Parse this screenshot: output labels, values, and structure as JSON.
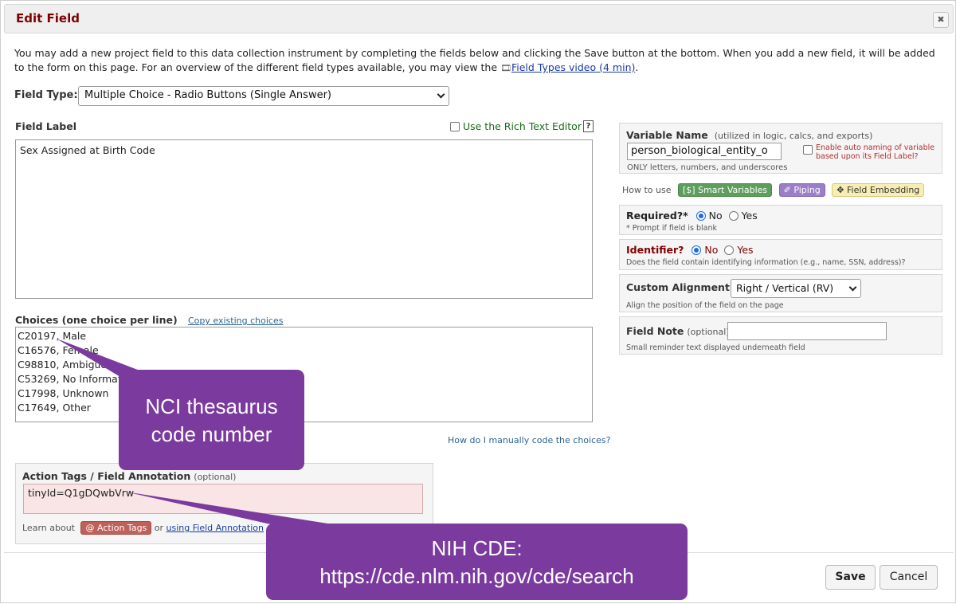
{
  "dialog": {
    "title": "Edit Field",
    "close_glyph": "✖"
  },
  "intro": {
    "text": "You may add a new project field to this data collection instrument by completing the fields below and clicking the Save button at the bottom. When you add a new field, it will be added to the form on this page. For an overview of the different field types available, you may view the",
    "film_glyph": "🎞",
    "video_link": "Field Types video (4 min)",
    "end": "."
  },
  "field_type": {
    "label": "Field Type:",
    "value": "Multiple Choice - Radio Buttons (Single Answer)"
  },
  "field_label": {
    "label": "Field Label",
    "rich_text_label": "Use the Rich Text Editor",
    "help_glyph": "?",
    "value": "Sex Assigned at Birth Code"
  },
  "choices": {
    "label": "Choices (one choice per line)",
    "copy_link": "Copy existing choices",
    "lines": [
      "C20197, Male",
      "C16576, Female",
      "C98810, Ambiguous",
      "C53269, No Information",
      "C17998, Unknown",
      "C17649, Other"
    ],
    "help_link": "How do I manually code the choices?"
  },
  "action_tags": {
    "label": "Action Tags / Field Annotation",
    "optional": "(optional)",
    "value": "tinyId=Q1gDQwbVrw",
    "learn_about": "Learn about",
    "action_tags_button": "@ Action Tags",
    "or": "or",
    "annotation_link": "using Field Annotation"
  },
  "variable": {
    "label": "Variable Name",
    "hint": "(utilized in logic, calcs, and exports)",
    "value": "person_biological_entity_o",
    "auto_naming": "Enable auto naming of variable based upon its Field Label?",
    "only_letters": "ONLY letters, numbers, and underscores"
  },
  "how_to_use": {
    "label": "How to use",
    "smart_variables": "[$] Smart Variables",
    "piping": "✐ Piping",
    "field_embedding": "✥ Field Embedding"
  },
  "required": {
    "label": "Required?*",
    "no": "No",
    "yes": "Yes",
    "note": "* Prompt if field is blank",
    "selected": "No"
  },
  "identifier": {
    "label": "Identifier?",
    "no": "No",
    "yes": "Yes",
    "note": "Does the field contain identifying information (e.g., name, SSN, address)?",
    "selected": "No"
  },
  "alignment": {
    "label": "Custom Alignment",
    "value": "Right / Vertical (RV)",
    "note": "Align the position of the field on the page"
  },
  "field_note": {
    "label": "Field Note",
    "optional": "(optional)",
    "value": "",
    "note": "Small reminder text displayed underneath field"
  },
  "footer": {
    "save": "Save",
    "cancel": "Cancel"
  },
  "callouts": {
    "nci_line1": "NCI thesaurus",
    "nci_line2": "code number",
    "nih_line1": "NIH CDE:",
    "nih_line2": "https://cde.nlm.nih.gov/cde/search"
  },
  "colors": {
    "title": "#800000",
    "callout": "#7a3a9e",
    "link": "#1a3c9c"
  }
}
